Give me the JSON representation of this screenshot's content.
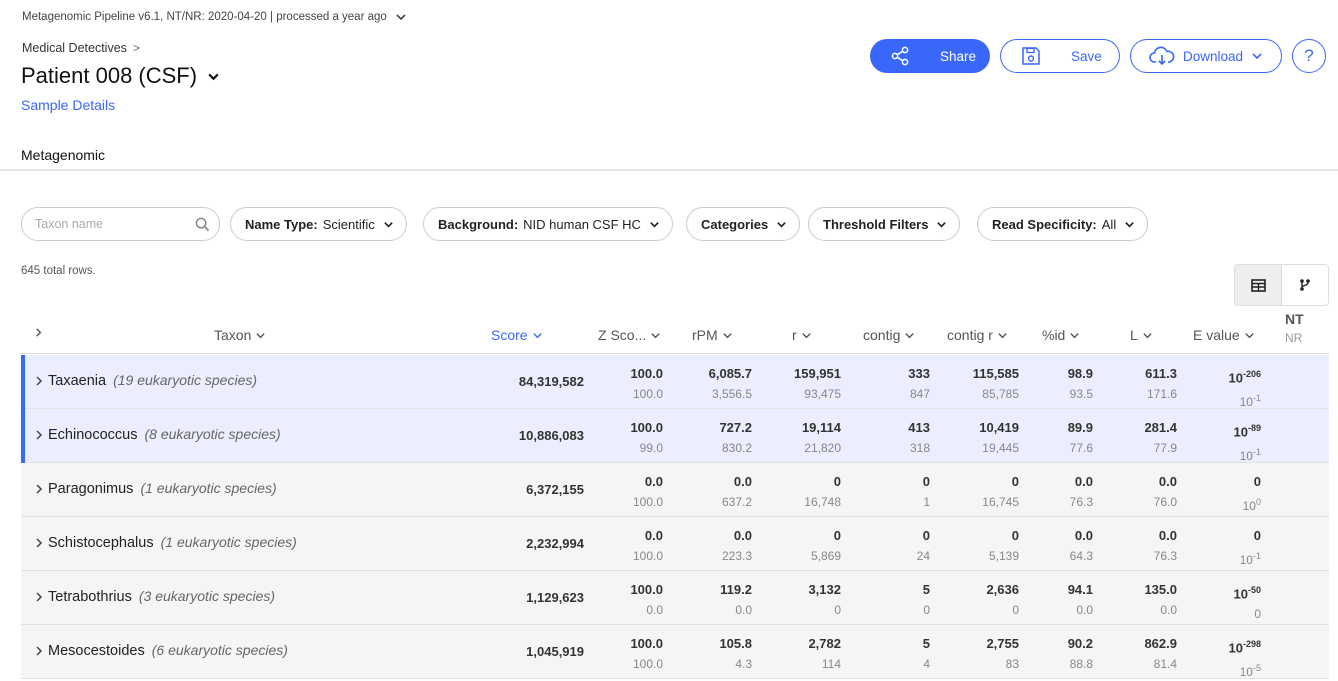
{
  "header": {
    "pipeline_info": "Metagenomic Pipeline v6.1, NT/NR: 2020-04-20 | processed a year ago",
    "breadcrumb": "Medical Detectives",
    "breadcrumb_sep": ">",
    "sample_title": "Patient 008 (CSF)",
    "sample_details_link": "Sample Details"
  },
  "actions": {
    "share": "Share",
    "save": "Save",
    "download": "Download",
    "help": "?"
  },
  "tabs": [
    {
      "label": "Metagenomic",
      "active": true
    }
  ],
  "filters": {
    "search_placeholder": "Taxon name",
    "name_type_label": "Name Type:",
    "name_type_value": "Scientific",
    "background_label": "Background:",
    "background_value": "NID human CSF HC",
    "categories": "Categories",
    "threshold": "Threshold Filters",
    "read_specificity_label": "Read Specificity:",
    "read_specificity_value": "All"
  },
  "total_rows": "645 total rows.",
  "table": {
    "expand_all": ">",
    "columns": {
      "taxon": "Taxon",
      "score": "Score",
      "z_score": "Z Sco...",
      "rpm": "rPM",
      "r": "r",
      "contig": "contig",
      "contig_r": "contig r",
      "pct_id": "%id",
      "l": "L",
      "e_value": "E value",
      "nt": "NT",
      "nr": "NR"
    },
    "rows": [
      {
        "name": "Taxaenia",
        "species": "(19 eukaryotic species)",
        "score": "84,319,582",
        "z": [
          "100.0",
          "100.0"
        ],
        "rpm": [
          "6,085.7",
          "3,556.5"
        ],
        "r": [
          "159,951",
          "93,475"
        ],
        "contig": [
          "333",
          "847"
        ],
        "contig_r": [
          "115,585",
          "85,785"
        ],
        "pct_id": [
          "98.9",
          "93.5"
        ],
        "l": [
          "611.3",
          "171.6"
        ],
        "e_nt_base": "10",
        "e_nt_exp": "-206",
        "e_nr_base": "10",
        "e_nr_exp": "-1",
        "highlight": true
      },
      {
        "name": "Echinococcus",
        "species": "(8 eukaryotic species)",
        "score": "10,886,083",
        "z": [
          "100.0",
          "99.0"
        ],
        "rpm": [
          "727.2",
          "830.2"
        ],
        "r": [
          "19,114",
          "21,820"
        ],
        "contig": [
          "413",
          "318"
        ],
        "contig_r": [
          "10,419",
          "19,445"
        ],
        "pct_id": [
          "89.9",
          "77.6"
        ],
        "l": [
          "281.4",
          "77.9"
        ],
        "e_nt_base": "10",
        "e_nt_exp": "-89",
        "e_nr_base": "10",
        "e_nr_exp": "-1",
        "highlight": true
      },
      {
        "name": "Paragonimus",
        "species": "(1 eukaryotic species)",
        "score": "6,372,155",
        "z": [
          "0.0",
          "100.0"
        ],
        "rpm": [
          "0.0",
          "637.2"
        ],
        "r": [
          "0",
          "16,748"
        ],
        "contig": [
          "0",
          "1"
        ],
        "contig_r": [
          "0",
          "16,745"
        ],
        "pct_id": [
          "0.0",
          "76.3"
        ],
        "l": [
          "0.0",
          "76.0"
        ],
        "e_nt_base": "0",
        "e_nt_exp": "",
        "e_nr_base": "10",
        "e_nr_exp": "0",
        "highlight": false
      },
      {
        "name": "Schistocephalus",
        "species": "(1 eukaryotic species)",
        "score": "2,232,994",
        "z": [
          "0.0",
          "100.0"
        ],
        "rpm": [
          "0.0",
          "223.3"
        ],
        "r": [
          "0",
          "5,869"
        ],
        "contig": [
          "0",
          "24"
        ],
        "contig_r": [
          "0",
          "5,139"
        ],
        "pct_id": [
          "0.0",
          "64.3"
        ],
        "l": [
          "0.0",
          "76.3"
        ],
        "e_nt_base": "0",
        "e_nt_exp": "",
        "e_nr_base": "10",
        "e_nr_exp": "-1",
        "highlight": false
      },
      {
        "name": "Tetrabothrius",
        "species": "(3 eukaryotic species)",
        "score": "1,129,623",
        "z": [
          "100.0",
          "0.0"
        ],
        "rpm": [
          "119.2",
          "0.0"
        ],
        "r": [
          "3,132",
          "0"
        ],
        "contig": [
          "5",
          "0"
        ],
        "contig_r": [
          "2,636",
          "0"
        ],
        "pct_id": [
          "94.1",
          "0.0"
        ],
        "l": [
          "135.0",
          "0.0"
        ],
        "e_nt_base": "10",
        "e_nt_exp": "-50",
        "e_nr_base": "0",
        "e_nr_exp": "",
        "highlight": false
      },
      {
        "name": "Mesocestoides",
        "species": "(6 eukaryotic species)",
        "score": "1,045,919",
        "z": [
          "100.0",
          "100.0"
        ],
        "rpm": [
          "105.8",
          "4.3"
        ],
        "r": [
          "2,782",
          "114"
        ],
        "contig": [
          "5",
          "4"
        ],
        "contig_r": [
          "2,755",
          "83"
        ],
        "pct_id": [
          "90.2",
          "88.8"
        ],
        "l": [
          "862.9",
          "81.4"
        ],
        "e_nt_base": "10",
        "e_nt_exp": "-298",
        "e_nr_base": "10",
        "e_nr_exp": "-5",
        "highlight": false
      }
    ]
  },
  "colors": {
    "accent": "#3867fa",
    "row_highlight": "#eaeefe",
    "row_bg": "#f5f5f5"
  }
}
